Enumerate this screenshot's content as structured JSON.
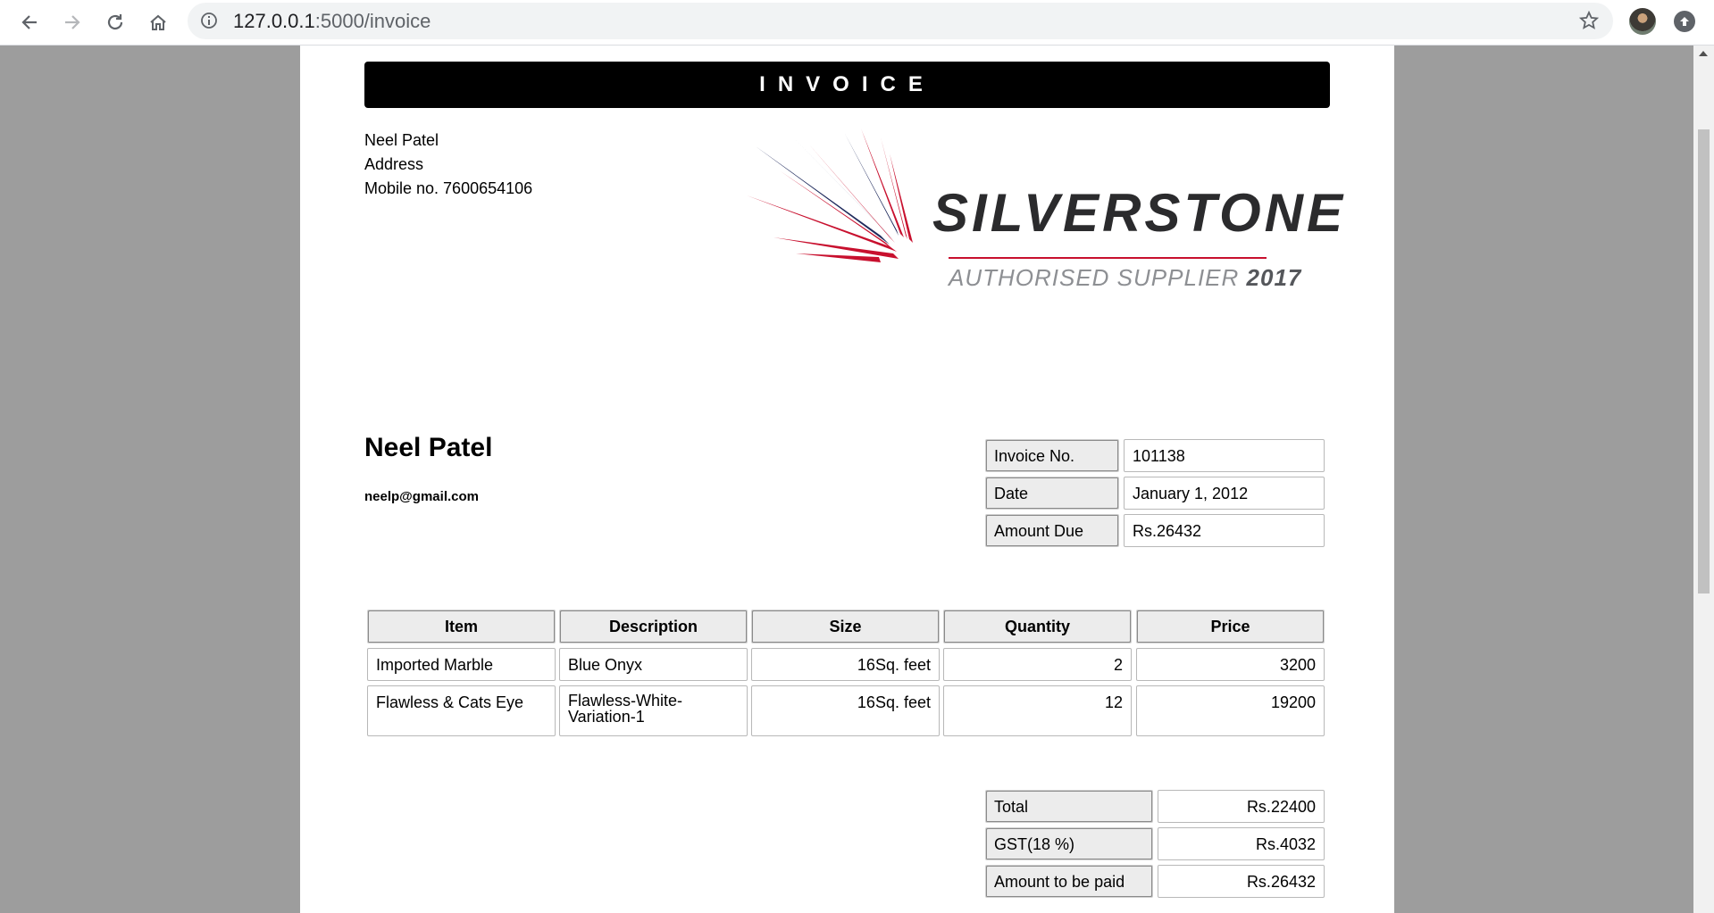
{
  "browser": {
    "url_host": "127.0.0.1",
    "url_rest": ":5000/invoice"
  },
  "invoice": {
    "banner_title": "INVOICE",
    "seller": {
      "name": "Neel Patel",
      "address": "Address",
      "mobile": "Mobile no. 7600654106"
    },
    "logo": {
      "brand": "SILVERSTONE",
      "tagline": "AUTHORISED SUPPLIER",
      "year": "2017",
      "colors": {
        "red": "#c8102e",
        "navy": "#1f2a5c"
      }
    },
    "customer": {
      "name": "Neel Patel",
      "email": "neelp@gmail.com"
    },
    "meta": [
      {
        "label": "Invoice No.",
        "value": "101138"
      },
      {
        "label": "Date",
        "value": "January 1, 2012"
      },
      {
        "label": "Amount Due",
        "value": "Rs.26432"
      }
    ],
    "items_table": {
      "headers": [
        "Item",
        "Description",
        "Size",
        "Quantity",
        "Price"
      ],
      "rows": [
        [
          "Imported Marble",
          "Blue Onyx",
          "16Sq. feet",
          "2",
          "3200"
        ],
        [
          "Flawless & Cats Eye",
          "Flawless-White-\nVariation-1",
          "16Sq. feet",
          "12",
          "19200"
        ]
      ]
    },
    "totals": [
      {
        "label": "Total",
        "value": "Rs.22400"
      },
      {
        "label": "GST(18 %)",
        "value": "Rs.4032"
      },
      {
        "label": "Amount to be paid",
        "value": "Rs.26432"
      }
    ]
  }
}
